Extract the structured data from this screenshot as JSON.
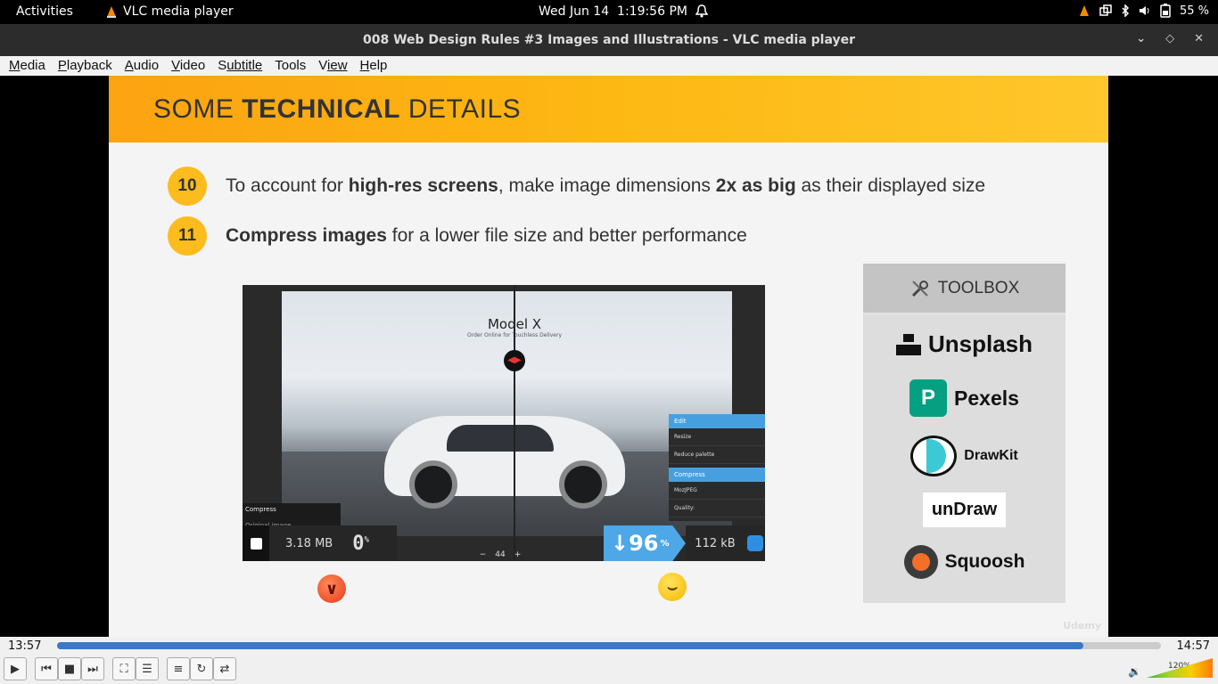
{
  "topbar": {
    "activities": "Activities",
    "app_name": "VLC media player",
    "date": "Wed Jun 14",
    "time": "1:19:56 PM",
    "battery": "55 %"
  },
  "window": {
    "title": "008 Web Design Rules #3 Images and Illustrations - VLC media player"
  },
  "menu": [
    {
      "key": "M",
      "rest": "edia"
    },
    {
      "key": "P",
      "rest": "layback"
    },
    {
      "key": "A",
      "rest": "udio"
    },
    {
      "key": "V",
      "rest": "ideo"
    },
    {
      "key": "S",
      "rest": "ubtitle"
    },
    {
      "key": "T",
      "rest": "ools"
    },
    {
      "key": "V",
      "rest": "iew"
    },
    {
      "key": "H",
      "rest": "elp"
    }
  ],
  "slide": {
    "heading_light": "SOME ",
    "heading_bold": "TECHNICAL",
    "heading_end": " DETAILS",
    "rule10": {
      "num": "10",
      "a": "To account for ",
      "b": "high-res screens",
      "c": ", make image dimensions ",
      "d": "2x as big",
      "e": " as their displayed size"
    },
    "rule11": {
      "num": "11",
      "a": "Compress images",
      "b": " for a lower file size and better performance"
    },
    "demo": {
      "model_title": "Model X",
      "model_sub": "Order Online for Touchless Delivery",
      "left_panel_title": "Compress",
      "left_panel_sub": "Original image",
      "left_size": "3.18 MB",
      "left_pct": "0",
      "pct_sign": "%",
      "right_pct": "↓96",
      "right_size": "112 kB",
      "edit": "Edit",
      "resize": "Resize",
      "reduce": "Reduce palette",
      "compress": "Compress",
      "codec": "MozJPEG",
      "quality": "Quality:",
      "zoom": "44"
    },
    "toolbox": {
      "title": "TOOLBOX",
      "items": [
        "Unsplash",
        "Pexels",
        "DrawKit",
        "unDraw",
        "Squoosh"
      ]
    },
    "watermark": "Udemy"
  },
  "player": {
    "elapsed": "13:57",
    "total": "14:57",
    "progress": 0.93,
    "volume": "120%"
  },
  "colors": {
    "banner": "#fcb316",
    "badge": "#fcbc1e",
    "seek": "#3a78c9"
  }
}
